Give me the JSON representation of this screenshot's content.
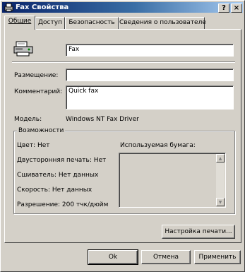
{
  "window": {
    "title": "Fax Свойства",
    "help_label": "?",
    "close_label": "×"
  },
  "tabs": [
    {
      "label": "Общие",
      "active": true
    },
    {
      "label": "Доступ",
      "active": false
    },
    {
      "label": "Безопасность",
      "active": false
    },
    {
      "label": "Сведения о пользователе",
      "active": false
    }
  ],
  "general": {
    "printer_name": "Fax",
    "location_label": "Размещение:",
    "location_value": "",
    "comment_label": "Комментарий:",
    "comment_value": "Quick fax",
    "model_label": "Модель:",
    "model_value": "Windows NT Fax Driver"
  },
  "features": {
    "title": "Возможности",
    "color": "Цвет: Нет",
    "duplex": "Двусторонняя печать: Нет",
    "staple": "Сшиватель: Нет данных",
    "speed": "Скорость: Нет данных",
    "resolution": "Разрешение: 200 тчк/дюйм",
    "paper_label": "Используемая бумага:",
    "paper_items": []
  },
  "buttons": {
    "print_prefs": "Настройка печати...",
    "ok": "Ok",
    "cancel": "Отмена",
    "apply": "Применить"
  },
  "colors": {
    "titlebar_start": "#0a246a",
    "titlebar_end": "#a6caf0",
    "face": "#d4d0c8"
  }
}
